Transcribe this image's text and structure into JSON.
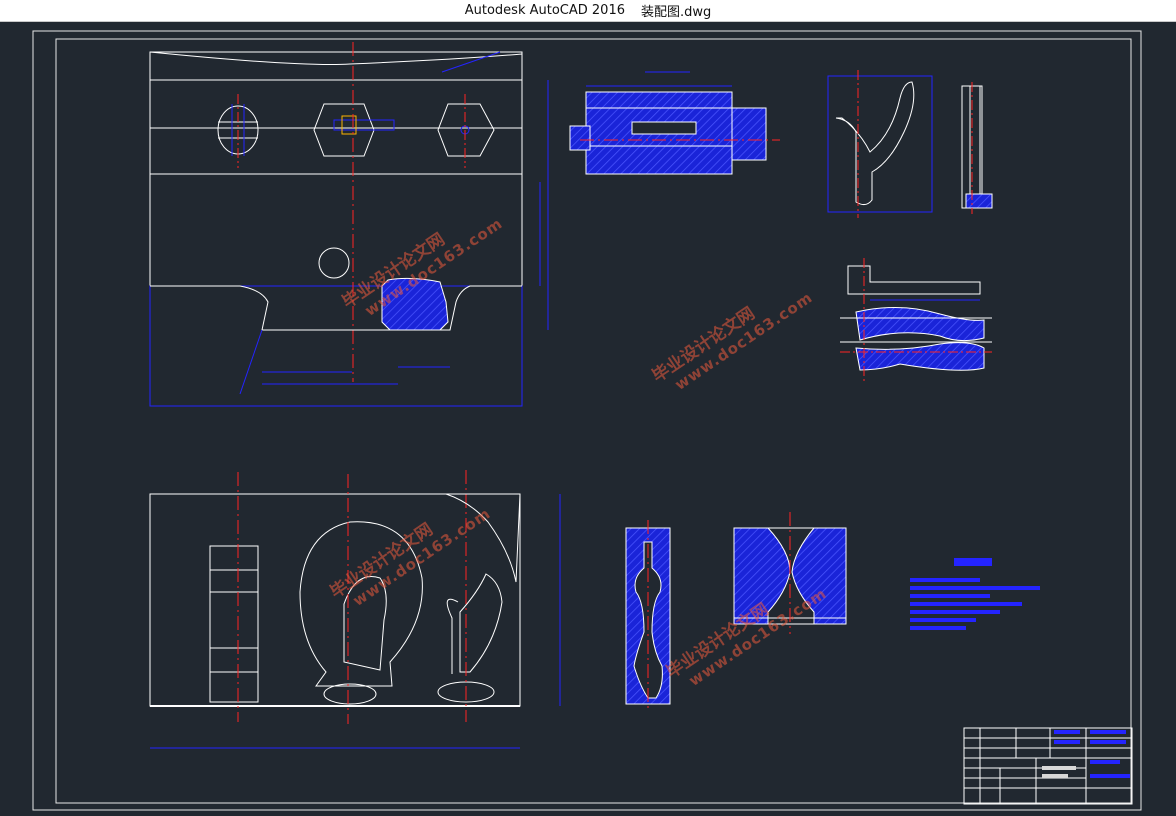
{
  "window": {
    "app_name": "Autodesk AutoCAD 2016",
    "file_name": "装配图.dwg"
  },
  "watermark": {
    "line1": "毕业设计论文网",
    "line2": "www.doc163.com"
  },
  "colors": {
    "background": "#212830",
    "outline": "#ffffff",
    "dimension": "#2424ff",
    "hatch": "#1a24e0",
    "centerline": "#ff2424",
    "watermark": "#eb5a3c"
  }
}
